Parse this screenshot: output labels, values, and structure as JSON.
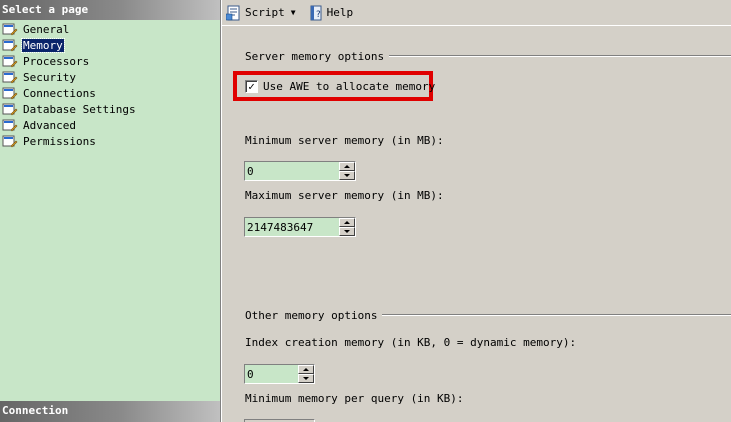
{
  "sidebar": {
    "header": "Select a page",
    "items": [
      {
        "label": "General",
        "selected": false
      },
      {
        "label": "Memory",
        "selected": true
      },
      {
        "label": "Processors",
        "selected": false
      },
      {
        "label": "Security",
        "selected": false
      },
      {
        "label": "Connections",
        "selected": false
      },
      {
        "label": "Database Settings",
        "selected": false
      },
      {
        "label": "Advanced",
        "selected": false
      },
      {
        "label": "Permissions",
        "selected": false
      }
    ],
    "footer_header": "Connection"
  },
  "toolbar": {
    "script_label": "Script",
    "help_label": "Help"
  },
  "server_memory": {
    "group_title": "Server memory options",
    "awe_label": "Use AWE to allocate memory",
    "awe_checked": true,
    "min_label": "Minimum server memory (in MB):",
    "min_value": "0",
    "max_label": "Maximum server memory (in MB):",
    "max_value": "2147483647"
  },
  "other_memory": {
    "group_title": "Other memory options",
    "index_label": "Index creation memory (in KB, 0 = dynamic memory):",
    "index_value": "0",
    "min_query_label": "Minimum memory per query (in KB):"
  },
  "colors": {
    "sidebar_bg": "#c8e6c8",
    "highlight": "#e00000",
    "selection": "#0a246a"
  }
}
